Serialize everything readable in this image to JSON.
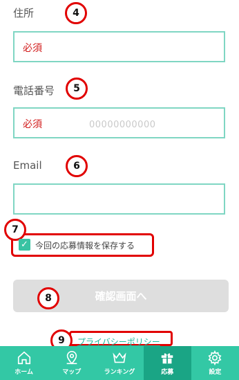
{
  "address": {
    "label": "住所",
    "required": "必須",
    "badge": "4"
  },
  "phone": {
    "label": "電話番号",
    "required": "必須",
    "placeholder": "00000000000",
    "badge": "5"
  },
  "email": {
    "label": "Email",
    "badge": "6"
  },
  "save_info": {
    "label": "今回の応募情報を保存する",
    "checked": true,
    "badge": "7"
  },
  "confirm": {
    "label": "確認画面へ",
    "badge": "8"
  },
  "privacy": {
    "label": "プライバシーポリシー",
    "badge": "9"
  },
  "tabs": [
    {
      "label": "ホーム",
      "icon": "home-icon"
    },
    {
      "label": "マップ",
      "icon": "map-pin-icon"
    },
    {
      "label": "ランキング",
      "icon": "crown-icon"
    },
    {
      "label": "応募",
      "icon": "gift-icon",
      "active": true
    },
    {
      "label": "設定",
      "icon": "gear-icon"
    }
  ],
  "colors": {
    "accent": "#33c8a5",
    "active_tab": "#1aa585",
    "required": "#d11a1a",
    "annotation": "#e10000"
  }
}
